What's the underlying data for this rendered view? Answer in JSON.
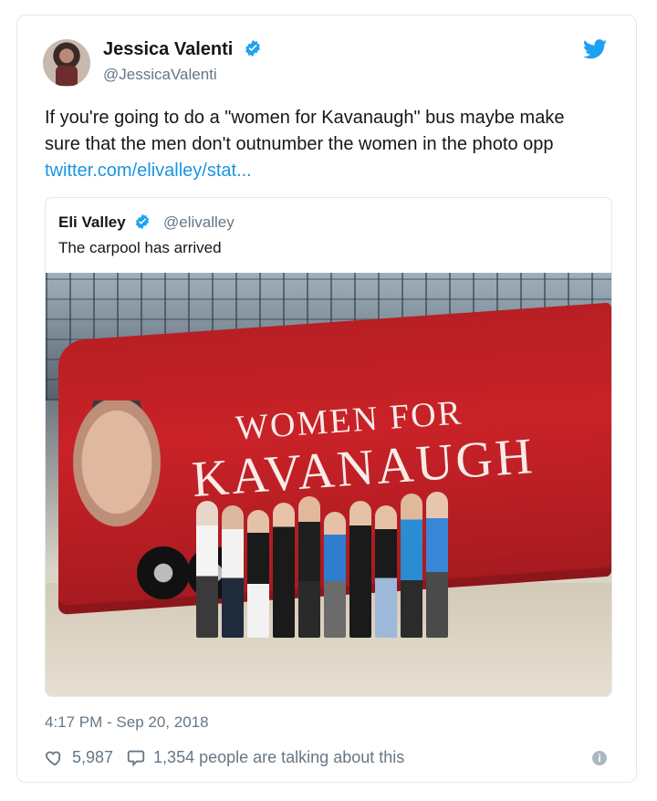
{
  "tweet": {
    "author": {
      "name": "Jessica Valenti",
      "handle": "@JessicaValenti"
    },
    "text_line1": "If you're going to do a \"women for Kavanaugh\" bus maybe make",
    "text_line2": "sure that the men don't outnumber the women in the photo opp",
    "link": "twitter.com/elivalley/stat...",
    "timestamp": "4:17 PM - Sep 20, 2018",
    "likes": "5,987",
    "talking": "1,354 people are talking about this"
  },
  "quoted": {
    "author": {
      "name": "Eli Valley",
      "handle": "@elivalley"
    },
    "text": "The carpool has arrived",
    "photo": {
      "bus_text_line1": "WOMEN FOR",
      "bus_text_line2": "KAVANAUGH"
    }
  },
  "colors": {
    "brand_blue": "#1da1f2",
    "link_blue": "#1b95e0",
    "muted": "#657786"
  },
  "icons": {
    "verified": "verified-badge-icon",
    "twitter": "twitter-bird-icon",
    "like": "heart-icon",
    "reply": "speech-bubble-icon",
    "info": "info-icon"
  }
}
